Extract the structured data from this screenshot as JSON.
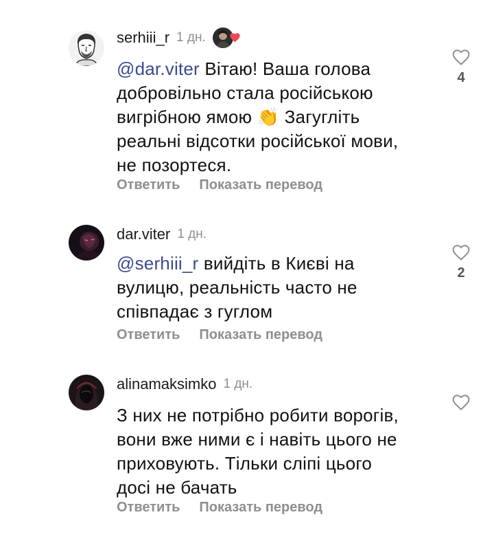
{
  "comments": [
    {
      "username": "serhiii_r",
      "time": "1 дн.",
      "author_liked": true,
      "mention": "@dar.viter",
      "text_line1_after_mention": " Вітаю! Ваша голова",
      "text_lines": [
        "добровільно стала російською",
        "вигрібною ямою 👏 Загугліть",
        "реальні відсотки російської мови,",
        "не позортеся."
      ],
      "reply_label": "Ответить",
      "translate_label": "Показать перевод",
      "like_count": "4",
      "avatar_icon": "man-portrait-icon"
    },
    {
      "username": "dar.viter",
      "time": "1 дн.",
      "mention": "@serhiii_r",
      "text_line1_after_mention": " вийдіть в Києві на",
      "text_lines": [
        "вулицю, реальність часто не",
        "співпадає з гуглом"
      ],
      "reply_label": "Ответить",
      "translate_label": "Показать перевод",
      "like_count": "2",
      "avatar_icon": "dark-portrait-icon"
    },
    {
      "username": "alinamaksimko",
      "time": "1 дн.",
      "text_lines": [
        "З них не потрібно робити ворогів,",
        "вони вже ними є і навіть цього не",
        "приховують. Тільки сліпі цього",
        "досі не бачать"
      ],
      "reply_label": "Ответить",
      "translate_label": "Показать перевод",
      "like_count": "",
      "avatar_icon": "hooded-figure-icon"
    }
  ],
  "colors": {
    "mention": "#3b4a8f",
    "muted": "#8e8e8e",
    "like_red": "#ed4956"
  }
}
